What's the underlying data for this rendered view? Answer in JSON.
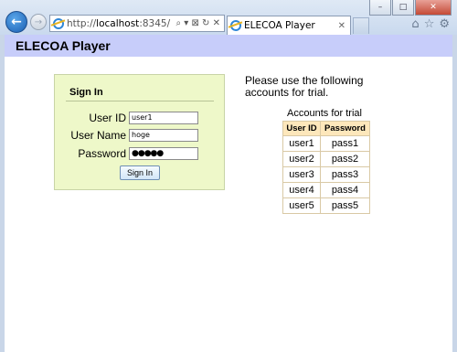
{
  "browser": {
    "url_prefix": "http://",
    "url_host": "localhost",
    "url_suffix": ":8345/",
    "tab_title": "ELECOA Player",
    "address_tools": "⌕ ▾ ⊠ ↻ ✕",
    "window_buttons": [
      "–",
      "□",
      "✕"
    ]
  },
  "page": {
    "header_title": "ELECOA Player"
  },
  "signin": {
    "title": "Sign In",
    "user_id_label": "User ID",
    "user_id_value": "user1",
    "user_name_label": "User Name",
    "user_name_value": "hoge",
    "password_label": "Password",
    "password_value": "●●●●●",
    "button_label": "Sign In"
  },
  "trial": {
    "message": "Please use the following accounts for trial.",
    "caption": "Accounts for trial",
    "columns": [
      "User ID",
      "Password"
    ],
    "rows": [
      [
        "user1",
        "pass1"
      ],
      [
        "user2",
        "pass2"
      ],
      [
        "user3",
        "pass3"
      ],
      [
        "user4",
        "pass4"
      ],
      [
        "user5",
        "pass5"
      ]
    ]
  }
}
